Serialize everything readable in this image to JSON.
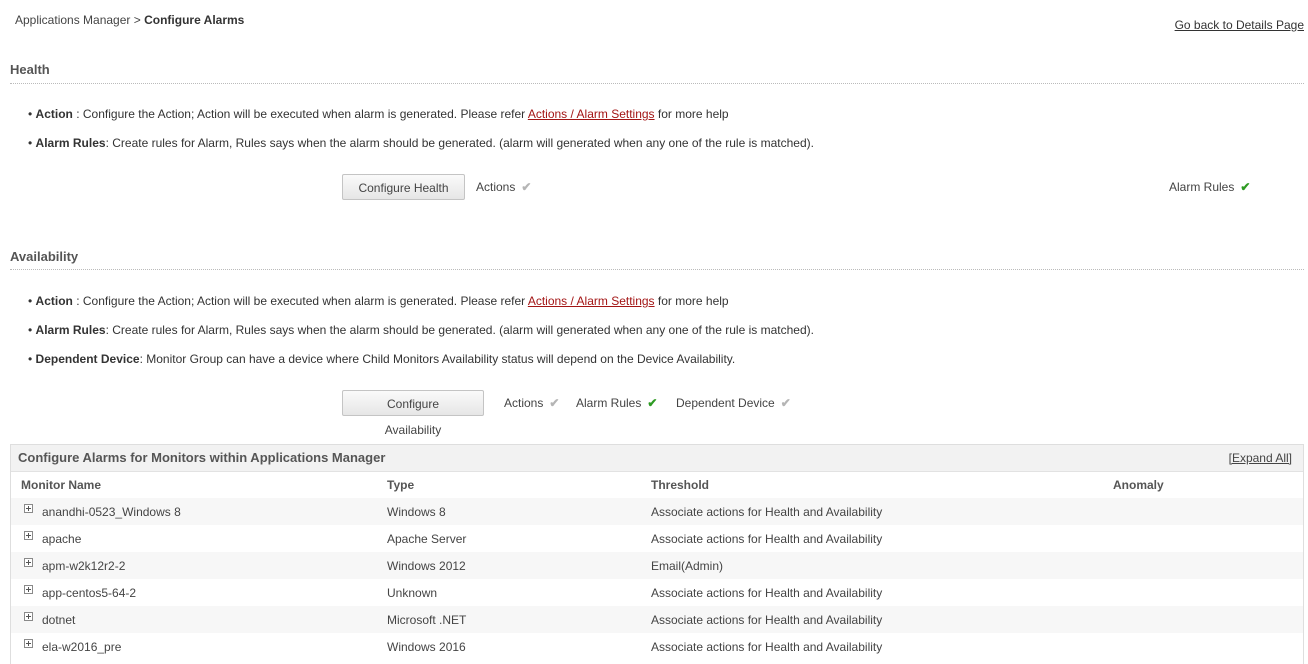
{
  "breadcrumb": {
    "parent": "Applications Manager",
    "separator": ">",
    "current": "Configure Alarms"
  },
  "back_link": "Go back to Details Page",
  "health": {
    "title": "Health",
    "action_label": "Action",
    "action_text_pre": " : Configure the Action; Action will be executed when alarm is generated. Please refer ",
    "action_link": "Actions / Alarm Settings",
    "action_text_post": " for more help",
    "rules_label": "Alarm Rules",
    "rules_text": ": Create rules for Alarm, Rules says when the alarm should be generated. (alarm will generated when any one of the rule is matched).",
    "button": "Configure Health",
    "status_actions": "Actions",
    "status_rules": "Alarm Rules"
  },
  "availability": {
    "title": "Availability",
    "action_label": "Action",
    "action_text_pre": " : Configure the Action; Action will be executed when alarm is generated. Please refer ",
    "action_link": "Actions / Alarm Settings",
    "action_text_post": " for more help",
    "rules_label": "Alarm Rules",
    "rules_text": ": Create rules for Alarm, Rules says when the alarm should be generated. (alarm will generated when any one of the rule is matched).",
    "device_label": "Dependent Device",
    "device_text": ": Monitor Group can have a device where Child Monitors Availability status will depend on the Device Availability.",
    "button": "Configure Availability",
    "status_actions": "Actions",
    "status_rules": "Alarm Rules",
    "status_device": "Dependent Device"
  },
  "check_glyph": "✔",
  "colors": {
    "check_grey": "#b5b5b5",
    "check_green": "#2e9b23",
    "link_red": "#a31515"
  },
  "monitors": {
    "title": "Configure Alarms for Monitors within Applications Manager",
    "expand_all": "[Expand All]",
    "columns": {
      "name": "Monitor Name",
      "type": "Type",
      "threshold": "Threshold",
      "anomaly": "Anomaly"
    },
    "rows": [
      {
        "name": "anandhi-0523_Windows 8",
        "type": "Windows 8",
        "threshold": "Associate actions for Health and Availability",
        "anomaly": ""
      },
      {
        "name": "apache",
        "type": "Apache Server",
        "threshold": "Associate actions for Health and Availability",
        "anomaly": ""
      },
      {
        "name": "apm-w2k12r2-2",
        "type": "Windows 2012",
        "threshold": "Email(Admin)",
        "anomaly": ""
      },
      {
        "name": "app-centos5-64-2",
        "type": "Unknown",
        "threshold": "Associate actions for Health and Availability",
        "anomaly": ""
      },
      {
        "name": "dotnet",
        "type": "Microsoft .NET",
        "threshold": "Associate actions for Health and Availability",
        "anomaly": ""
      },
      {
        "name": "ela-w2016_pre",
        "type": "Windows 2016",
        "threshold": "Associate actions for Health and Availability",
        "anomaly": ""
      }
    ]
  }
}
